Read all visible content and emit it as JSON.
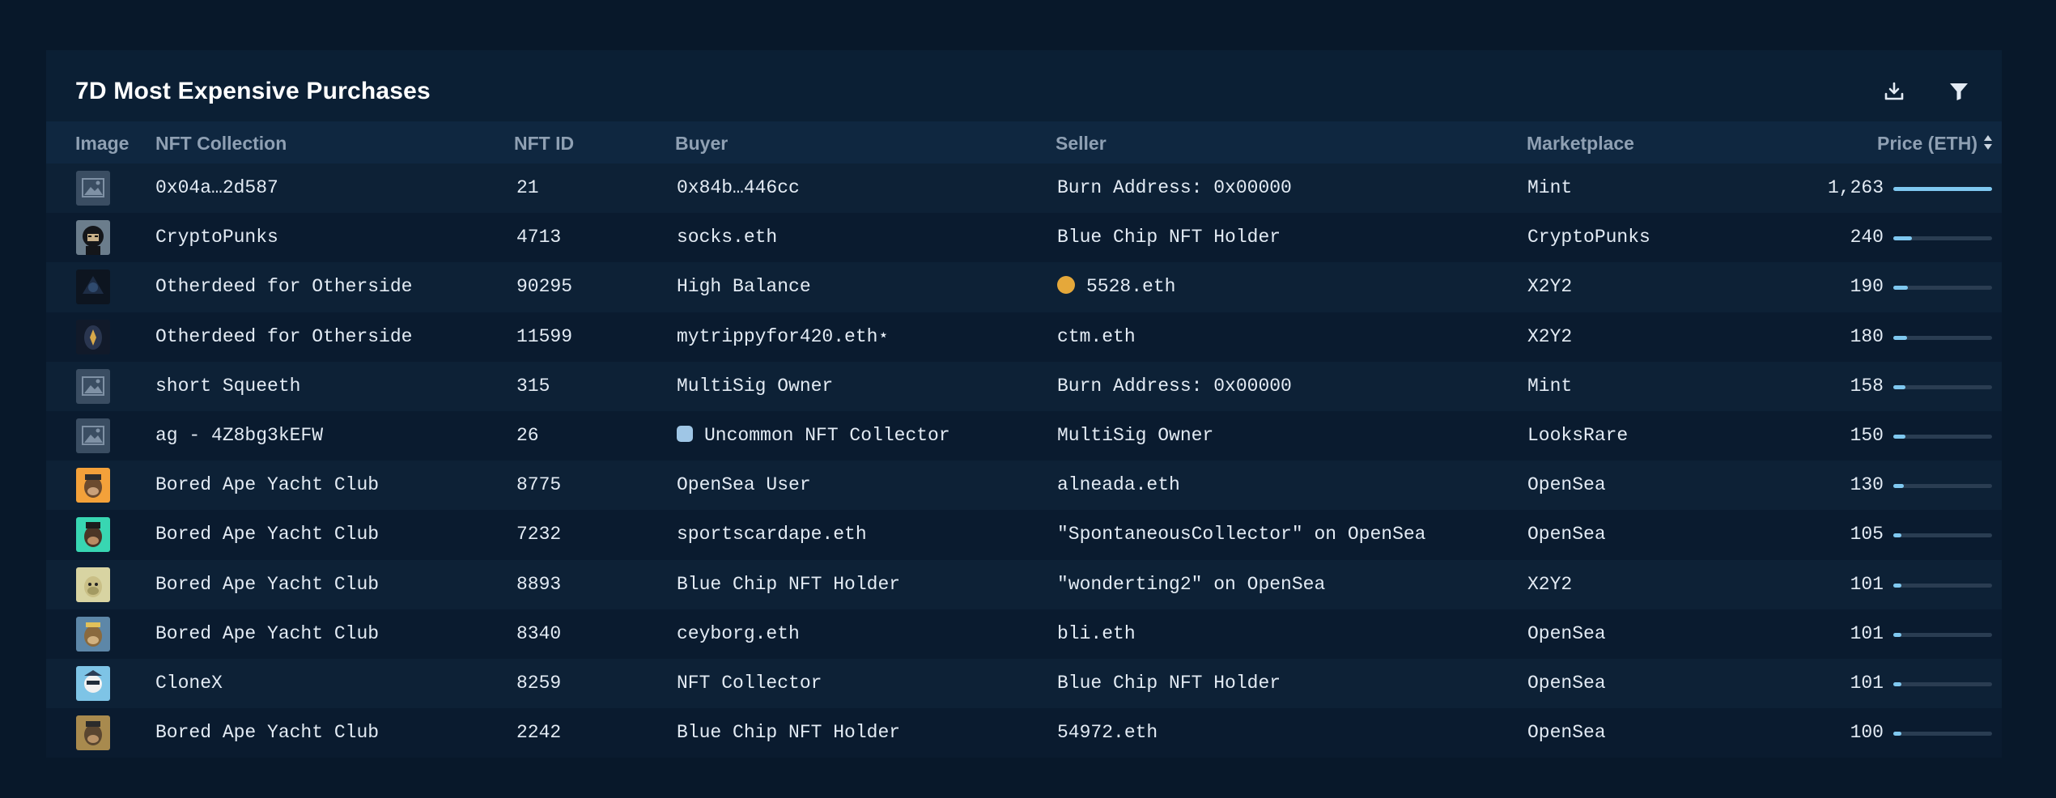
{
  "title": "7D Most Expensive Purchases",
  "toolbar": {
    "download_icon": "download-icon",
    "filter_icon": "filter-icon"
  },
  "columns": {
    "image": "Image",
    "collection": "NFT Collection",
    "nft_id": "NFT ID",
    "buyer": "Buyer",
    "seller": "Seller",
    "marketplace": "Marketplace",
    "price": "Price (ETH)"
  },
  "colors": {
    "bar_fill": "#7fc8f0",
    "bar_track": "#2a3d52",
    "panel": "#0b1f34",
    "header": "#0f2740"
  },
  "max_price": 1263,
  "rows": [
    {
      "thumb": "placeholder",
      "collection": "0x04a…2d587",
      "nft_id": "21",
      "buyer": "0x84b…446cc",
      "buyer_badge": "",
      "seller": "Burn Address: 0x00000",
      "seller_badge": "",
      "marketplace": "Mint",
      "price": "1,263",
      "price_value": 1263
    },
    {
      "thumb": "punk",
      "collection": "CryptoPunks",
      "nft_id": "4713",
      "buyer": "socks.eth",
      "buyer_badge": "",
      "seller": "Blue Chip NFT Holder",
      "seller_badge": "",
      "marketplace": "CryptoPunks",
      "price": "240",
      "price_value": 240
    },
    {
      "thumb": "otherdeed-dark",
      "collection": "Otherdeed for Otherside",
      "nft_id": "90295",
      "buyer": "High Balance",
      "buyer_badge": "",
      "seller": "5528.eth",
      "seller_badge": "face",
      "marketplace": "X2Y2",
      "price": "190",
      "price_value": 190
    },
    {
      "thumb": "otherdeed-gold",
      "collection": "Otherdeed for Otherside",
      "nft_id": "11599",
      "buyer": "mytrippyfor420.eth⋆",
      "buyer_badge": "",
      "seller": "ctm.eth",
      "seller_badge": "",
      "marketplace": "X2Y2",
      "price": "180",
      "price_value": 180
    },
    {
      "thumb": "placeholder",
      "collection": "short Squeeth",
      "nft_id": "315",
      "buyer": "MultiSig Owner",
      "buyer_badge": "",
      "seller": "Burn Address: 0x00000",
      "seller_badge": "",
      "marketplace": "Mint",
      "price": "158",
      "price_value": 158
    },
    {
      "thumb": "placeholder",
      "collection": "ag - 4Z8bg3kEFW",
      "nft_id": "26",
      "buyer": "Uncommon NFT Collector",
      "buyer_badge": "robot",
      "seller": "MultiSig Owner",
      "seller_badge": "",
      "marketplace": "LooksRare",
      "price": "150",
      "price_value": 150
    },
    {
      "thumb": "ape-orange",
      "collection": "Bored Ape Yacht Club",
      "nft_id": "8775",
      "buyer": "OpenSea User",
      "buyer_badge": "",
      "seller": "alneada.eth",
      "seller_badge": "",
      "marketplace": "OpenSea",
      "price": "130",
      "price_value": 130
    },
    {
      "thumb": "ape-teal",
      "collection": "Bored Ape Yacht Club",
      "nft_id": "7232",
      "buyer": "sportscardape.eth",
      "buyer_badge": "",
      "seller": "\"SpontaneousCollector\" on OpenSea",
      "seller_badge": "",
      "marketplace": "OpenSea",
      "price": "105",
      "price_value": 105
    },
    {
      "thumb": "ape-cream",
      "collection": "Bored Ape Yacht Club",
      "nft_id": "8893",
      "buyer": "Blue Chip NFT Holder",
      "buyer_badge": "",
      "seller": "\"wonderting2\" on OpenSea",
      "seller_badge": "",
      "marketplace": "X2Y2",
      "price": "101",
      "price_value": 101
    },
    {
      "thumb": "ape-blue",
      "collection": "Bored Ape Yacht Club",
      "nft_id": "8340",
      "buyer": "ceyborg.eth",
      "buyer_badge": "",
      "seller": "bli.eth",
      "seller_badge": "",
      "marketplace": "OpenSea",
      "price": "101",
      "price_value": 101
    },
    {
      "thumb": "clonex",
      "collection": "CloneX",
      "nft_id": "8259",
      "buyer": "NFT Collector",
      "buyer_badge": "",
      "seller": "Blue Chip NFT Holder",
      "seller_badge": "",
      "marketplace": "OpenSea",
      "price": "101",
      "price_value": 101
    },
    {
      "thumb": "ape-khaki",
      "collection": "Bored Ape Yacht Club",
      "nft_id": "2242",
      "buyer": "Blue Chip NFT Holder",
      "buyer_badge": "",
      "seller": "54972.eth",
      "seller_badge": "",
      "marketplace": "OpenSea",
      "price": "100",
      "price_value": 100
    }
  ]
}
